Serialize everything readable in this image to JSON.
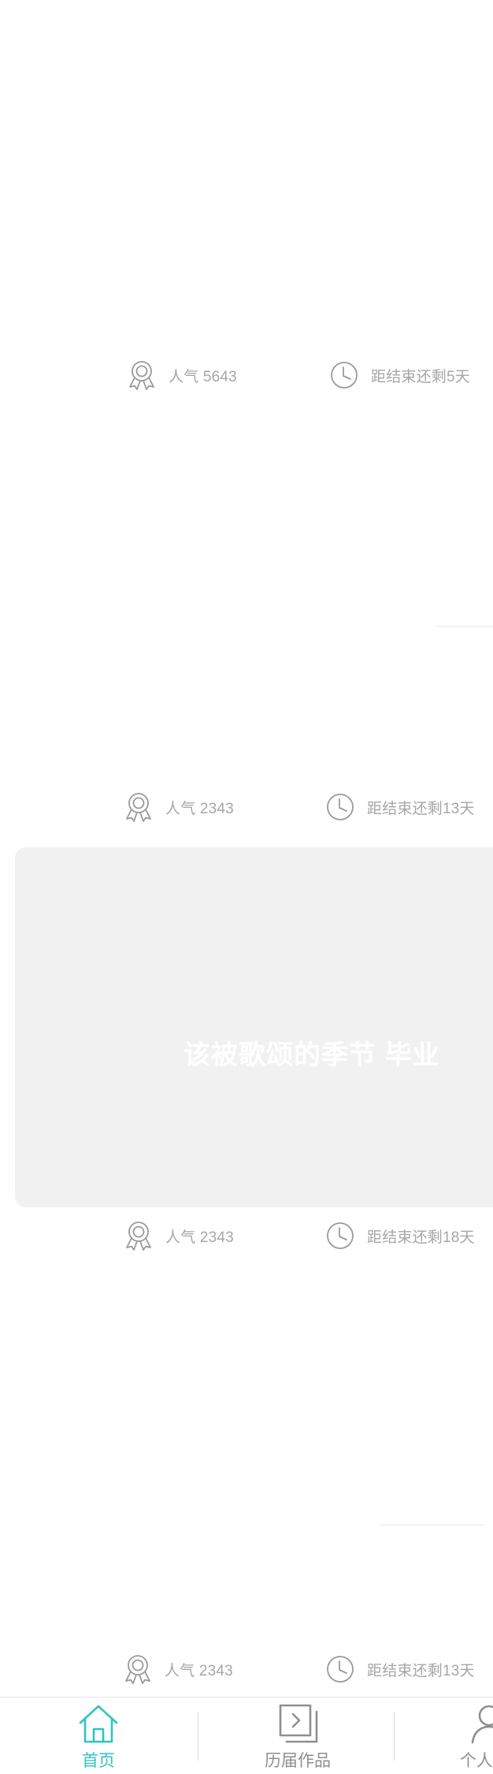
{
  "cards": [
    {
      "popularity": "人气 5643",
      "remaining": "距结束还剩5天"
    },
    {
      "popularity": "人气 2343",
      "remaining": "距结束还剩13天"
    },
    {
      "popularity": "人气 2343",
      "remaining": "距结束还剩18天",
      "banner_title": "该被歌颂的季节 毕业"
    },
    {
      "popularity": "人气 2343",
      "remaining": "距结束还剩13天"
    }
  ],
  "icons": {
    "popularity": "award-ribbon-icon",
    "remaining": "clock-icon"
  },
  "tabbar": {
    "tabs": [
      {
        "label": "首页",
        "icon": "home-icon",
        "active": true
      },
      {
        "label": "历届作品",
        "icon": "past-works-icon",
        "active": false
      },
      {
        "label": "个人",
        "icon": "user-icon",
        "active": false
      }
    ]
  },
  "colors": {
    "accent": "#2ec5c1",
    "text_muted": "#a6a6a6",
    "icon_gray": "#9a9a9a",
    "banner_bg": "#f1f1f1"
  }
}
